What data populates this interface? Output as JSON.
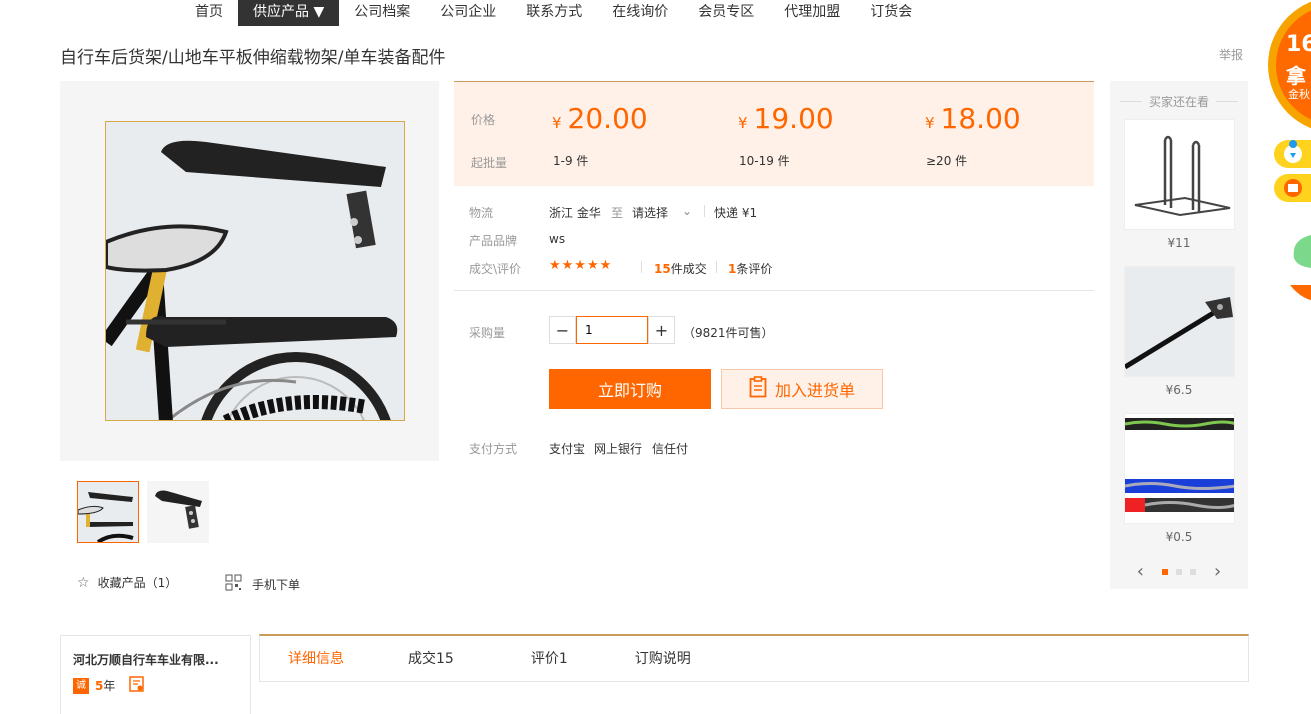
{
  "nav": {
    "items": [
      "首页",
      "供应产品 ▼",
      "公司档案",
      "公司企业",
      "联系方式",
      "在线询价",
      "会员专区",
      "代理加盟",
      "订货会"
    ]
  },
  "product": {
    "title": "自行车后货架/山地车平板伸缩载物架/单车装备配件",
    "report": "举报"
  },
  "price": {
    "label": "价格",
    "qty_label": "起批量",
    "currency": "¥",
    "tiers": [
      {
        "price": "20.00",
        "qty": "1-9 件"
      },
      {
        "price": "19.00",
        "qty": "10-19 件"
      },
      {
        "price": "18.00",
        "qty": "≥20 件"
      }
    ]
  },
  "logistics": {
    "label": "物流",
    "from": "浙江 金华",
    "to": "至",
    "select": "请选择",
    "express": "快递 ¥1"
  },
  "brand": {
    "label": "产品品牌",
    "value": "ws"
  },
  "deals": {
    "label": "成交\\评价",
    "stars": "★★★★★",
    "count": "15",
    "count_suffix": "件成交",
    "reviews": "1",
    "reviews_suffix": "条评价"
  },
  "purchase": {
    "label": "采购量",
    "minus": "−",
    "plus": "+",
    "value": "1",
    "available": "（9821件可售）"
  },
  "buttons": {
    "buy": "立即订购",
    "cart": "加入进货单"
  },
  "payment": {
    "label": "支付方式",
    "methods": [
      "支付宝",
      "网上银行",
      "信任付"
    ]
  },
  "actions": {
    "favorite": "收藏产品（1）",
    "mobile": "手机下单"
  },
  "sidebar": {
    "title": "买家还在看",
    "items": [
      {
        "price": "¥11"
      },
      {
        "price": "¥6.5"
      },
      {
        "price": "¥0.5"
      }
    ]
  },
  "shop": {
    "name": "河北万顺自行车车业有限...",
    "years": "5",
    "years_suffix": "年"
  },
  "tabs": [
    "详细信息",
    "成交15",
    "评价1",
    "订购说明"
  ],
  "promo": {
    "text1": "16",
    "text2": "拿",
    "text3": "金秋"
  },
  "colors": {
    "accent": "#ff6600",
    "price_bg": "#fff1e8",
    "gold": "#c99b5a"
  }
}
